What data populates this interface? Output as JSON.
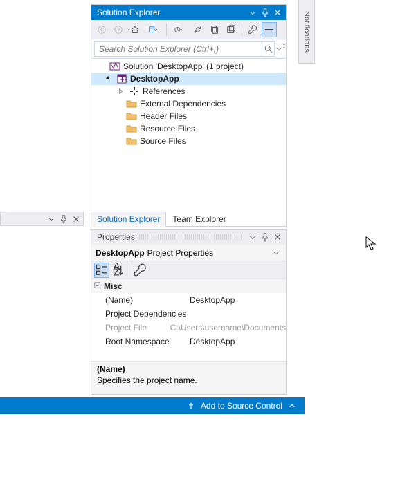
{
  "notifications_tab": "Notifications",
  "left_stub": {},
  "solution_explorer": {
    "title": "Solution Explorer",
    "search_placeholder": "Search Solution Explorer (Ctrl+;)",
    "tree": {
      "solution_label": "Solution 'DesktopApp' (1 project)",
      "project_label": "DesktopApp",
      "references": "References",
      "external_deps": "External Dependencies",
      "header_files": "Header Files",
      "resource_files": "Resource Files",
      "source_files": "Source Files"
    },
    "tabs": {
      "active": "Solution Explorer",
      "other": "Team Explorer"
    }
  },
  "properties": {
    "title": "Properties",
    "subject_name": "DesktopApp",
    "subject_type": "Project Properties",
    "category": "Misc",
    "rows": {
      "name_label": "(Name)",
      "name_value": "DesktopApp",
      "deps_label": "Project Dependencies",
      "deps_value": "",
      "file_label": "Project File",
      "file_value": "C:\\Users\\username\\Documents",
      "ns_label": "Root Namespace",
      "ns_value": "DesktopApp"
    },
    "desc_header": "(Name)",
    "desc_body": "Specifies the project name."
  },
  "statusbar": {
    "source_control": "Add to Source Control"
  }
}
